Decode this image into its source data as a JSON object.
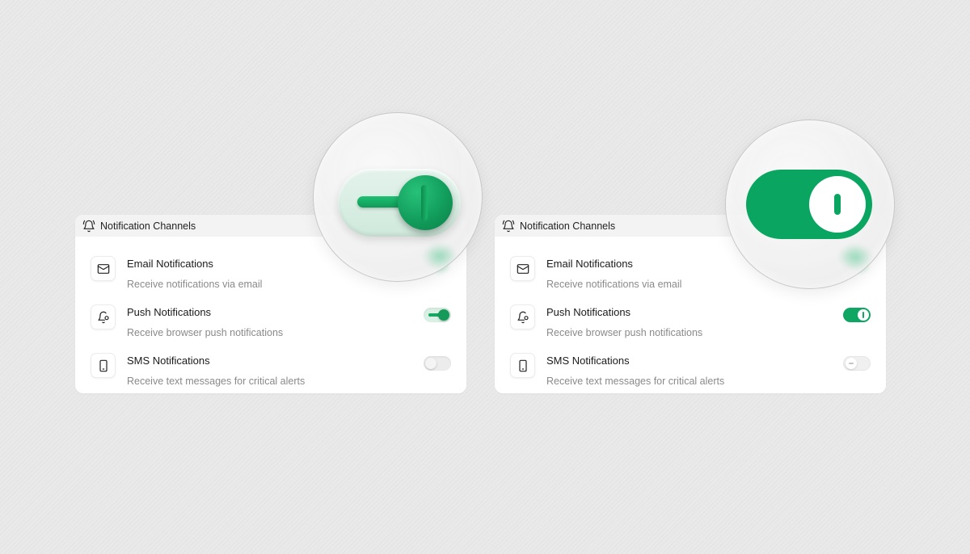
{
  "panels": [
    {
      "header": {
        "title": "Notification Channels",
        "icon": "bell-icon"
      },
      "items": [
        {
          "title": "Email Notifications",
          "description": "Receive notifications via email",
          "icon": "mail-icon",
          "toggle": "on"
        },
        {
          "title": "Push Notifications",
          "description": "Receive browser push notifications",
          "icon": "bell-settings-icon",
          "toggle": "on"
        },
        {
          "title": "SMS Notifications",
          "description": "Receive text messages for critical alerts",
          "icon": "phone-icon",
          "toggle": "off"
        }
      ],
      "style": "3d"
    },
    {
      "header": {
        "title": "Notification Channels",
        "icon": "bell-icon"
      },
      "items": [
        {
          "title": "Email Notifications",
          "description": "Receive notifications via email",
          "icon": "mail-icon",
          "toggle": "on"
        },
        {
          "title": "Push Notifications",
          "description": "Receive browser push notifications",
          "icon": "bell-settings-icon",
          "toggle": "on"
        },
        {
          "title": "SMS Notifications",
          "description": "Receive text messages for critical alerts",
          "icon": "phone-icon",
          "toggle": "off"
        }
      ],
      "style": "flat"
    }
  ],
  "colors": {
    "accent": "#0fa563",
    "background": "#e9e9e9",
    "card": "#ffffff",
    "header": "#f3f3f3",
    "muted_text": "#8a8a8a"
  }
}
